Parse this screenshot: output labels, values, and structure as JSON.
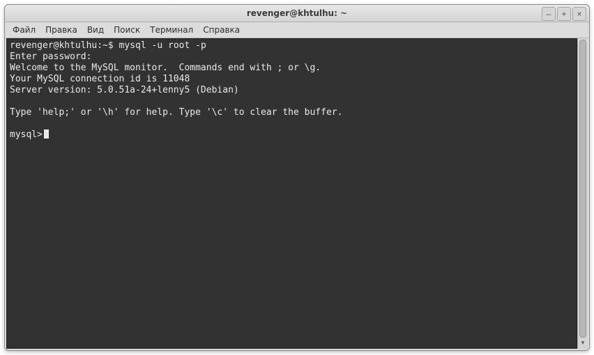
{
  "window": {
    "title": "revenger@khtulhu: ~"
  },
  "menu": {
    "items": [
      "Файл",
      "Правка",
      "Вид",
      "Поиск",
      "Терминал",
      "Справка"
    ]
  },
  "terminal": {
    "prompt": "revenger@khtulhu:~$",
    "command": "mysql -u root -p",
    "lines": [
      "Enter password:",
      "Welcome to the MySQL monitor.  Commands end with ; or \\g.",
      "Your MySQL connection id is 11048",
      "Server version: 5.0.51a-24+lenny5 (Debian)",
      "",
      "Type 'help;' or '\\h' for help. Type '\\c' to clear the buffer.",
      ""
    ],
    "mysql_prompt": "mysql>"
  },
  "winbtn": {
    "min": "–",
    "max": "+",
    "close": "×"
  }
}
